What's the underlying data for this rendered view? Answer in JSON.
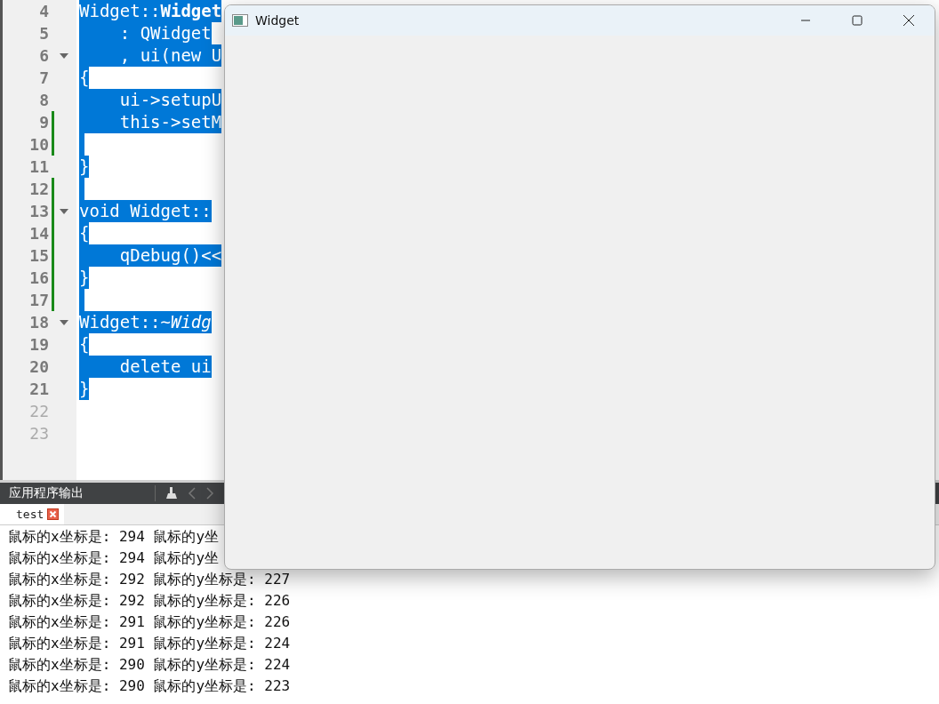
{
  "editor": {
    "lines": [
      {
        "number": "4",
        "text": "Widget::**Widget**",
        "selected": true,
        "foldable": false,
        "changed": false
      },
      {
        "number": "5",
        "text": "    : QWidget",
        "selected": true,
        "foldable": false,
        "changed": false
      },
      {
        "number": "6",
        "text": "    , ui(new U",
        "selected": true,
        "foldable": true,
        "changed": false
      },
      {
        "number": "7",
        "text": "{",
        "selected": true,
        "foldable": false,
        "changed": false
      },
      {
        "number": "8",
        "text": "    ui->setupU",
        "selected": true,
        "foldable": false,
        "changed": false
      },
      {
        "number": "9",
        "text": "    this->setM",
        "selected": true,
        "foldable": false,
        "changed": true
      },
      {
        "number": "10",
        "selected": true,
        "foldable": false,
        "changed": true
      },
      {
        "number": "11",
        "text": "}",
        "selected": true,
        "foldable": false,
        "changed": false
      },
      {
        "number": "12",
        "selected": true,
        "foldable": false,
        "changed": true
      },
      {
        "number": "13",
        "text": "void Widget::",
        "selected": true,
        "foldable": true,
        "changed": true
      },
      {
        "number": "14",
        "text": "{",
        "selected": true,
        "foldable": false,
        "changed": true
      },
      {
        "number": "15",
        "text": "    qDebug()<<",
        "selected": true,
        "foldable": false,
        "changed": true
      },
      {
        "number": "16",
        "text": "}",
        "selected": true,
        "foldable": false,
        "changed": true
      },
      {
        "number": "17",
        "selected": true,
        "foldable": false,
        "changed": true
      },
      {
        "number": "18",
        "text": "Widget::~*Widg*",
        "selected": true,
        "foldable": true,
        "changed": false
      },
      {
        "number": "19",
        "text": "{",
        "selected": true,
        "foldable": false,
        "changed": false
      },
      {
        "number": "20",
        "text": "    delete ui",
        "selected": true,
        "foldable": false,
        "changed": false
      },
      {
        "number": "21",
        "text": "}",
        "selected": true,
        "foldable": false,
        "changed": false
      },
      {
        "number": "22",
        "selected": false,
        "foldable": false,
        "changed": false
      },
      {
        "number": "23",
        "selected": false,
        "foldable": false,
        "changed": false
      }
    ]
  },
  "output_pane": {
    "title": "应用程序输出",
    "tabs": [
      {
        "label": "test",
        "selected": true
      }
    ],
    "lines": [
      "鼠标的x坐标是: 294 鼠标的y坐",
      "鼠标的x坐标是: 294 鼠标的y坐",
      "鼠标的x坐标是: 292 鼠标的y坐标是: 227",
      "鼠标的x坐标是: 292 鼠标的y坐标是: 226",
      "鼠标的x坐标是: 291 鼠标的y坐标是: 226",
      "鼠标的x坐标是: 291 鼠标的y坐标是: 224",
      "鼠标的x坐标是: 290 鼠标的y坐标是: 224",
      "鼠标的x坐标是: 290 鼠标的y坐标是: 223"
    ]
  },
  "window": {
    "title": "Widget"
  }
}
